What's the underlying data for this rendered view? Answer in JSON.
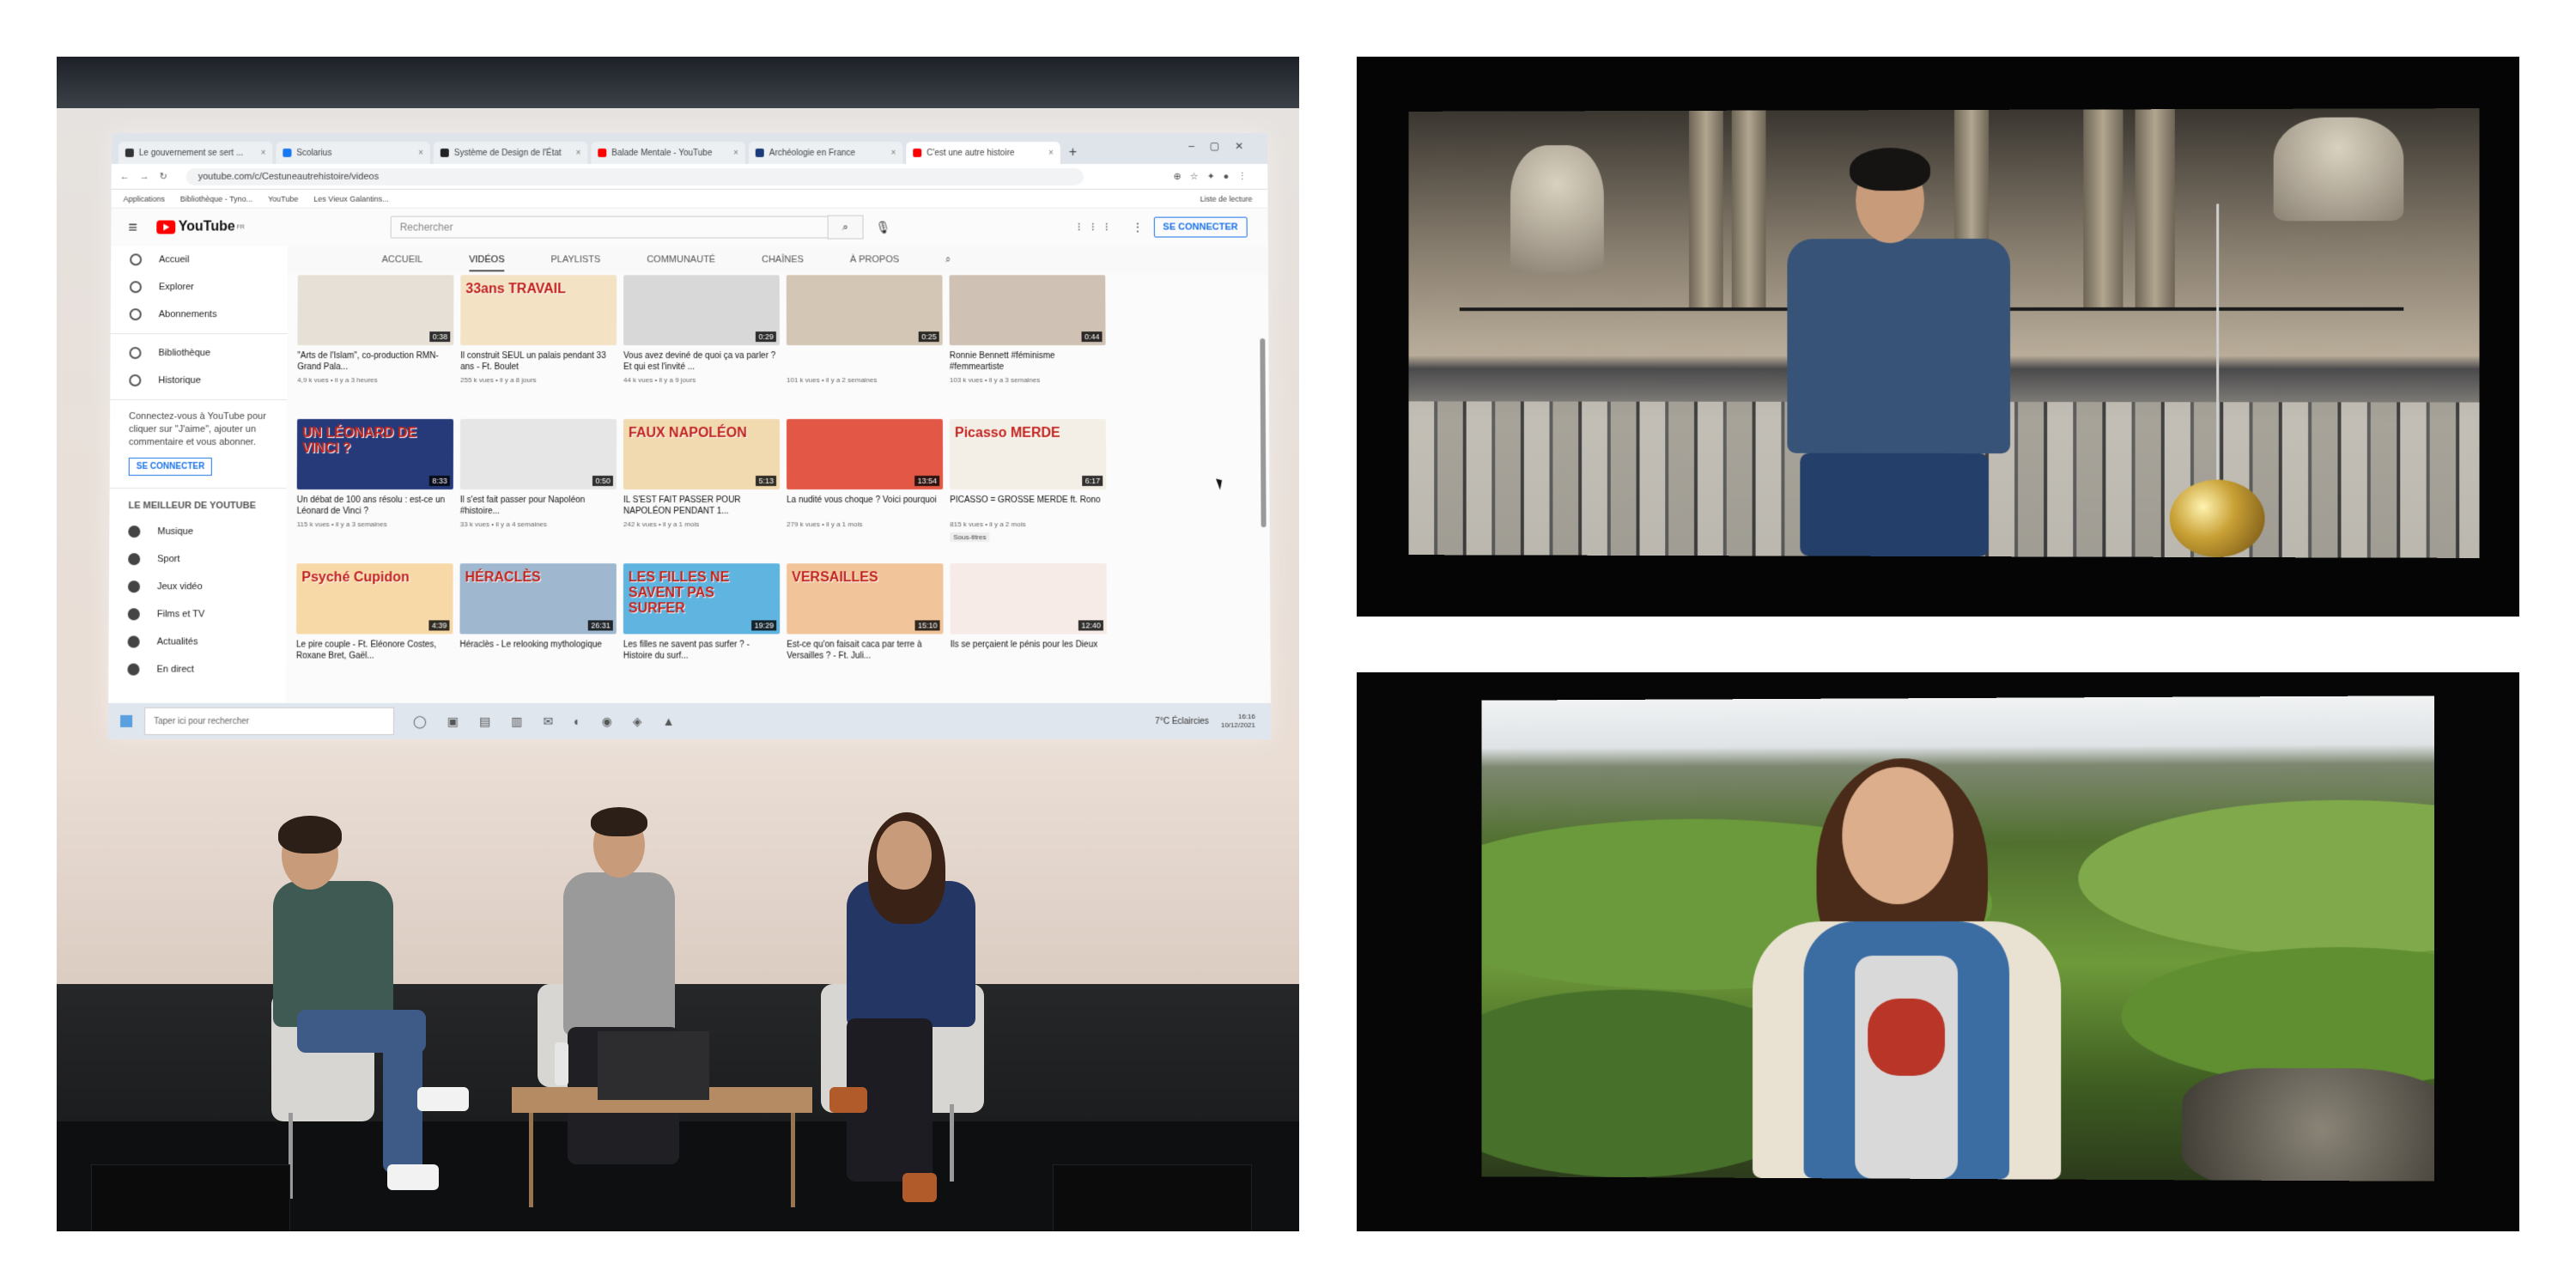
{
  "browser": {
    "tabs": [
      {
        "label": "Le gouvernement se sert ...",
        "color": "#333333"
      },
      {
        "label": "Scolarius",
        "color": "#1877f2"
      },
      {
        "label": "Système de Design de l'État",
        "color": "#222222"
      },
      {
        "label": "Balade Mentale - YouTube",
        "color": "#ff0000"
      },
      {
        "label": "Archéologie en France",
        "color": "#1b3a7a"
      },
      {
        "label": "C'est une autre histoire",
        "color": "#ff0000"
      }
    ],
    "url": "youtube.com/c/Cestuneautrehistoire/videos",
    "bookmarks": [
      "Applications",
      "Bibliothèque - Tyno...",
      "YouTube",
      "Les Vieux Galantins...",
      "Liste de lecture"
    ]
  },
  "youtube": {
    "logo": "YouTube",
    "logo_region": "FR",
    "search_placeholder": "Rechercher",
    "signin_label": "SE CONNECTER",
    "sidebar": {
      "items": [
        "Accueil",
        "Explorer",
        "Abonnements"
      ],
      "items2": [
        "Bibliothèque",
        "Historique"
      ],
      "prompt": "Connectez-vous à YouTube pour cliquer sur \"J'aime\", ajouter un commentaire et vous abonner.",
      "signin_label": "SE CONNECTER",
      "section_heading": "LE MEILLEUR DE YOUTUBE",
      "best": [
        "Musique",
        "Sport",
        "Jeux vidéo",
        "Films et TV",
        "Actualités",
        "En direct"
      ]
    },
    "channel_tabs": [
      "ACCUEIL",
      "VIDÉOS",
      "PLAYLISTS",
      "COMMUNAUTÉ",
      "CHAÎNES",
      "À PROPOS"
    ],
    "active_tab": "VIDÉOS",
    "videos": [
      [
        {
          "title": "\"Arts de l'Islam\", co-production RMN-Grand Pala...",
          "meta": "4,9 k vues • il y a 3 heures",
          "duration": "0:38",
          "thumb_text": "",
          "color": "#e7e0d6"
        },
        {
          "title": "Il construit SEUL un palais pendant 33 ans - Ft. Boulet",
          "meta": "255 k vues • il y a 8 jours",
          "duration": "",
          "thumb_text": "33ans TRAVAIL",
          "color": "#f3e2c3"
        },
        {
          "title": "Vous avez deviné de quoi ça va parler ? Et qui est l'invité ...",
          "meta": "44 k vues • il y a 9 jours",
          "duration": "0:29",
          "thumb_text": "",
          "color": "#d8d8d8"
        },
        {
          "title": "",
          "meta": "101 k vues • il y a 2 semaines",
          "duration": "0:25",
          "thumb_text": "",
          "color": "#d4c6b5"
        },
        {
          "title": "Ronnie Bennett #féminisme #femmeartiste",
          "meta": "103 k vues • il y a 3 semaines",
          "duration": "0:44",
          "thumb_text": "",
          "color": "#cfc2b4"
        }
      ],
      [
        {
          "title": "Un débat de 100 ans résolu : est-ce un Léonard de Vinci ?",
          "meta": "115 k vues • il y a 3 semaines",
          "duration": "8:33",
          "thumb_text": "UN LÉONARD DE VINCI ?",
          "color": "#263a7a"
        },
        {
          "title": "Il s'est fait passer pour Napoléon #histoire...",
          "meta": "33 k vues • il y a 4 semaines",
          "duration": "0:50",
          "thumb_text": "",
          "color": "#e6e6e6"
        },
        {
          "title": "IL S'EST FAIT PASSER POUR NAPOLÉON PENDANT 1...",
          "meta": "242 k vues • il y a 1 mois",
          "duration": "5:13",
          "thumb_text": "FAUX NAPOLÉON",
          "color": "#f1d9b0"
        },
        {
          "title": "La nudité vous choque ? Voici pourquoi",
          "meta": "279 k vues • il y a 1 mois",
          "duration": "13:54",
          "thumb_text": "",
          "color": "#e25745"
        },
        {
          "title": "PICASSO = GROSSE MERDE ft. Rono",
          "meta": "815 k vues • il y a 2 mois",
          "duration": "6:17",
          "thumb_text": "Picasso MERDE",
          "color": "#f4efe6",
          "badge": "Sous-titres"
        }
      ],
      [
        {
          "title": "Le pire couple - Ft. Éléonore Costes, Roxane Bret, Gaël...",
          "meta": "",
          "duration": "4:39",
          "thumb_text": "Psyché Cupidon",
          "color": "#f7d9a8"
        },
        {
          "title": "Héraclès - Le relooking mythologique",
          "meta": "",
          "duration": "26:31",
          "thumb_text": "HÉRACLÈS",
          "color": "#9fb8d0"
        },
        {
          "title": "Les filles ne savent pas surfer ? - Histoire du surf...",
          "meta": "",
          "duration": "19:29",
          "thumb_text": "LES FILLES NE SAVENT PAS SURFER",
          "color": "#5fb4e0"
        },
        {
          "title": "Est-ce qu'on faisait caca par terre à Versailles ? - Ft. Juli...",
          "meta": "",
          "duration": "15:10",
          "thumb_text": "VERSAILLES",
          "color": "#f2c49a"
        },
        {
          "title": "Ils se perçaient le pénis pour les Dieux",
          "meta": "",
          "duration": "12:40",
          "thumb_text": "",
          "color": "#f6ebe6"
        }
      ]
    ]
  },
  "taskbar": {
    "search_placeholder": "Taper ici pour rechercher",
    "weather": "7°C Éclaircies",
    "time": "16:16",
    "date": "10/12/2021"
  }
}
